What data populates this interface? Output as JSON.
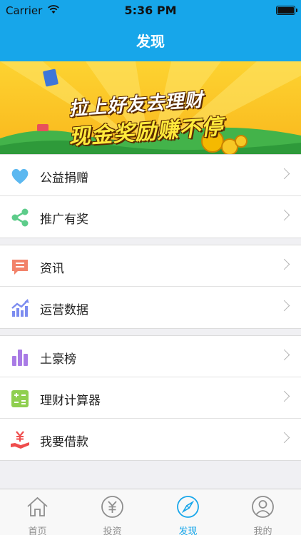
{
  "status_bar": {
    "carrier": "Carrier",
    "time": "5:36 PM",
    "battery_level": 1.0
  },
  "header": {
    "title": "发现"
  },
  "banner": {
    "line1": "拉上好友去理财",
    "line2": "现金奖励赚不停"
  },
  "menu_groups": [
    {
      "items": [
        {
          "label": "公益捐赠",
          "icon": "heart-icon",
          "color": "#5cb8f0"
        },
        {
          "label": "推广有奖",
          "icon": "share-icon",
          "color": "#5dcc8a"
        }
      ]
    },
    {
      "items": [
        {
          "label": "资讯",
          "icon": "message-icon",
          "color": "#f2826a"
        },
        {
          "label": "运营数据",
          "icon": "trend-chart-icon",
          "color": "#7c8cf0"
        }
      ]
    },
    {
      "items": [
        {
          "label": "土豪榜",
          "icon": "bar-chart-icon",
          "color": "#a97be5"
        },
        {
          "label": "理财计算器",
          "icon": "calculator-icon",
          "color": "#8fcf4f"
        },
        {
          "label": "我要借款",
          "icon": "loan-icon",
          "color": "#ef4d4d"
        }
      ]
    }
  ],
  "tabs": [
    {
      "label": "首页",
      "icon": "home-icon",
      "active": false
    },
    {
      "label": "投资",
      "icon": "yuan-icon",
      "active": false
    },
    {
      "label": "发现",
      "icon": "compass-icon",
      "active": true
    },
    {
      "label": "我的",
      "icon": "person-icon",
      "active": false
    }
  ],
  "colors": {
    "accent": "#17a6ea",
    "inactive": "#8e8e8e"
  }
}
